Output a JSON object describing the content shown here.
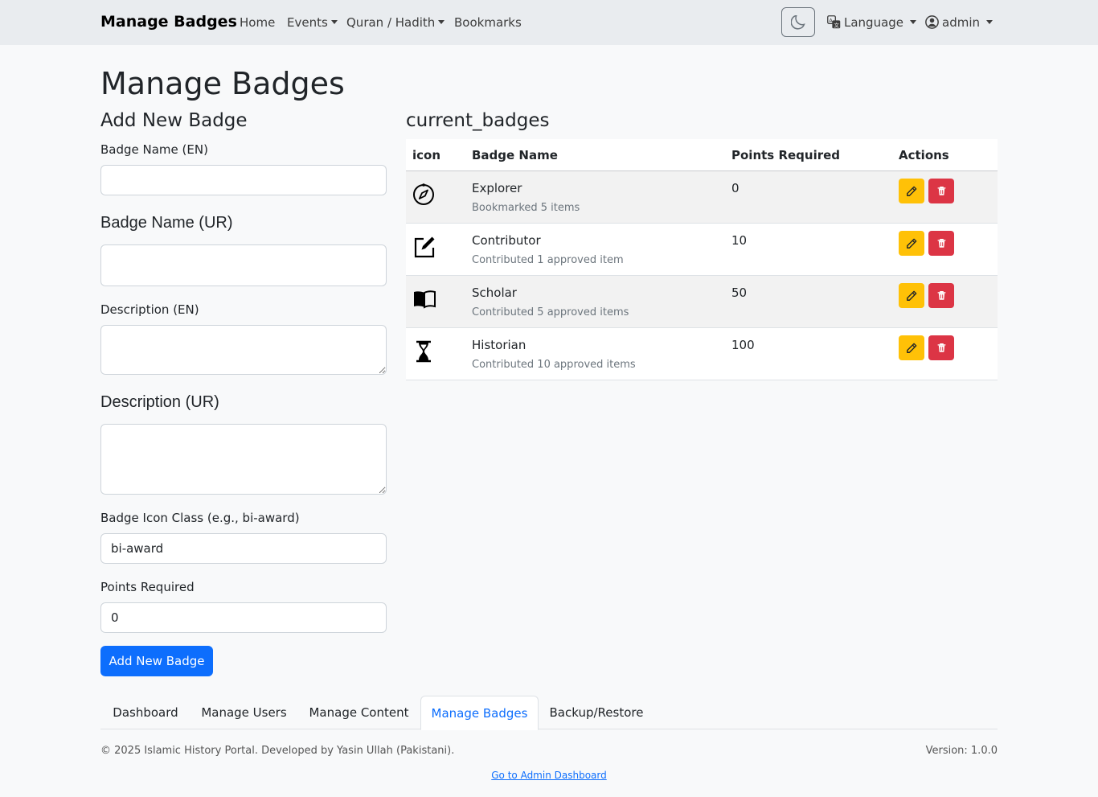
{
  "navbar": {
    "brand": "Manage Badges",
    "links": {
      "home": "Home",
      "events": "Events",
      "quran_hadith": "Quran / Hadith",
      "bookmarks": "Bookmarks"
    },
    "language": "Language",
    "user": "admin"
  },
  "page_title": "Manage Badges",
  "form": {
    "heading": "Add New Badge",
    "name_en_label": "Badge Name (EN)",
    "name_en_value": "",
    "name_ur_label": "Badge Name (UR)",
    "name_ur_value": "",
    "desc_en_label": "Description (EN)",
    "desc_en_value": "",
    "desc_ur_label": "Description (UR)",
    "desc_ur_value": "",
    "icon_label": "Badge Icon Class (e.g., bi-award)",
    "icon_value": "bi-award",
    "points_label": "Points Required",
    "points_value": "0",
    "submit_label": "Add New Badge"
  },
  "table": {
    "heading": "current_badges",
    "headers": {
      "icon": "icon",
      "name": "Badge Name",
      "points": "Points Required",
      "actions": "Actions"
    },
    "rows": [
      {
        "icon": "compass-icon",
        "name": "Explorer",
        "desc": "Bookmarked 5 items",
        "points": "0"
      },
      {
        "icon": "pencil-square-icon",
        "name": "Contributor",
        "desc": "Contributed 1 approved item",
        "points": "10"
      },
      {
        "icon": "book-icon",
        "name": "Scholar",
        "desc": "Contributed 5 approved items",
        "points": "50"
      },
      {
        "icon": "hourglass-icon",
        "name": "Historian",
        "desc": "Contributed 10 approved items",
        "points": "100"
      }
    ]
  },
  "tabs": [
    "Dashboard",
    "Manage Users",
    "Manage Content",
    "Manage Badges",
    "Backup/Restore"
  ],
  "active_tab": "Manage Badges",
  "footer": {
    "copyright": "© 2025 Islamic History Portal. Developed by Yasin Ullah (Pakistani).",
    "version": "Version: 1.0.0",
    "link": "Go to Admin Dashboard"
  },
  "colors": {
    "primary": "#0d6efd",
    "warning": "#ffc107",
    "danger": "#dc3545",
    "navbar_bg": "#e9ecef"
  }
}
